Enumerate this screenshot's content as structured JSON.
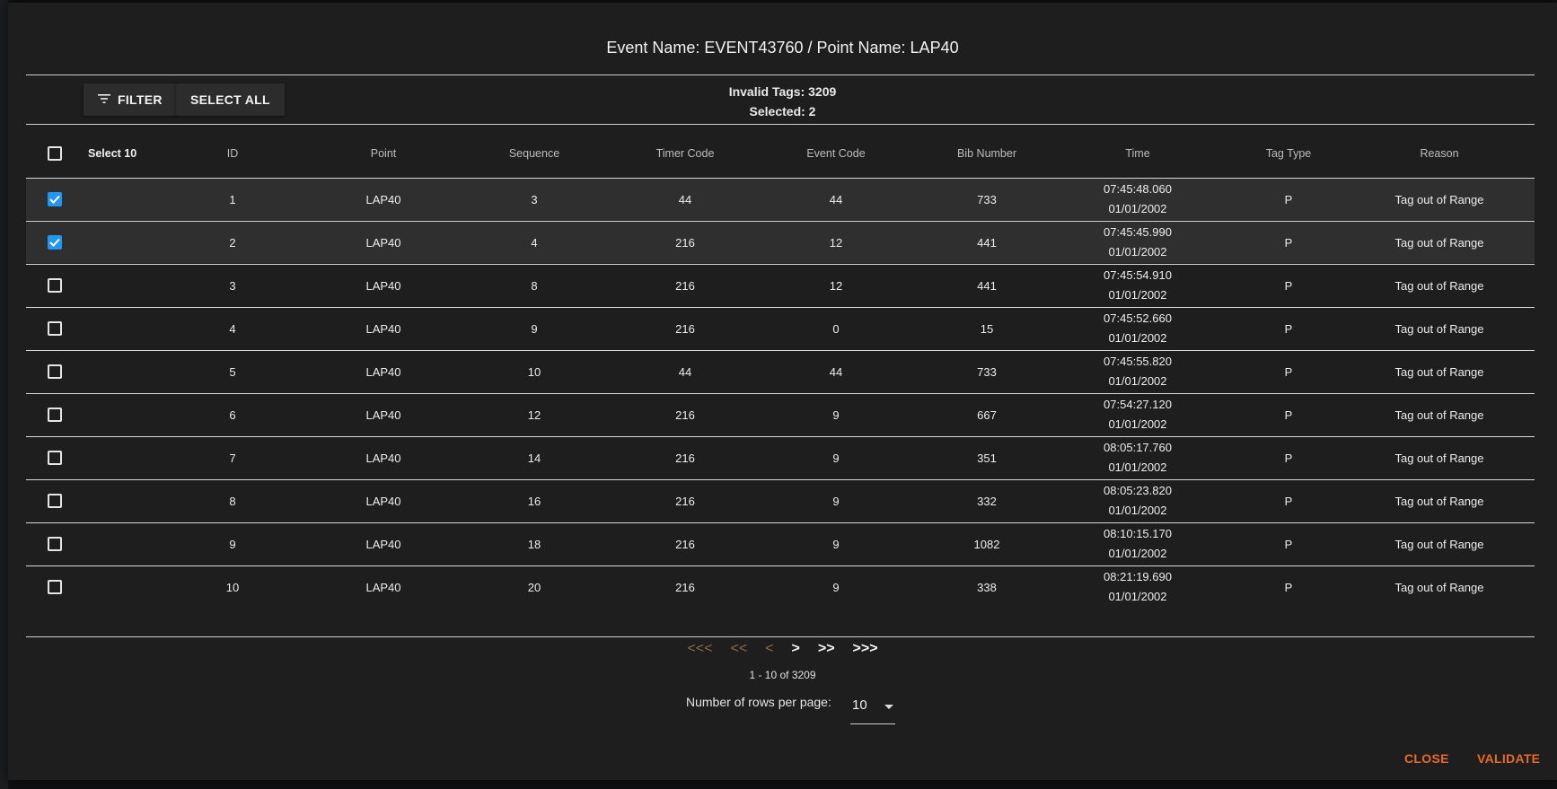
{
  "dialog": {
    "title": "Event Name: EVENT43760 / Point Name: LAP40",
    "toolbar": {
      "filter_label": "FILTER",
      "select_all_label": "SELECT ALL",
      "filter_icon": "filter-list-icon"
    },
    "stats": {
      "invalid_tags": "Invalid Tags: 3209",
      "selected": "Selected: 2"
    },
    "table": {
      "select_label": "Select 10",
      "columns": [
        "ID",
        "Point",
        "Sequence",
        "Timer Code",
        "Event Code",
        "Bib Number",
        "Time",
        "Tag Type",
        "Reason"
      ],
      "rows": [
        {
          "checked": true,
          "id": "1",
          "point": "LAP40",
          "sequence": "3",
          "timer_code": "44",
          "event_code": "44",
          "bib": "733",
          "time": "07:45:48.060",
          "date": "01/01/2002",
          "tag_type": "P",
          "reason": "Tag out of Range"
        },
        {
          "checked": true,
          "id": "2",
          "point": "LAP40",
          "sequence": "4",
          "timer_code": "216",
          "event_code": "12",
          "bib": "441",
          "time": "07:45:45.990",
          "date": "01/01/2002",
          "tag_type": "P",
          "reason": "Tag out of Range"
        },
        {
          "checked": false,
          "id": "3",
          "point": "LAP40",
          "sequence": "8",
          "timer_code": "216",
          "event_code": "12",
          "bib": "441",
          "time": "07:45:54.910",
          "date": "01/01/2002",
          "tag_type": "P",
          "reason": "Tag out of Range"
        },
        {
          "checked": false,
          "id": "4",
          "point": "LAP40",
          "sequence": "9",
          "timer_code": "216",
          "event_code": "0",
          "bib": "15",
          "time": "07:45:52.660",
          "date": "01/01/2002",
          "tag_type": "P",
          "reason": "Tag out of Range"
        },
        {
          "checked": false,
          "id": "5",
          "point": "LAP40",
          "sequence": "10",
          "timer_code": "44",
          "event_code": "44",
          "bib": "733",
          "time": "07:45:55.820",
          "date": "01/01/2002",
          "tag_type": "P",
          "reason": "Tag out of Range"
        },
        {
          "checked": false,
          "id": "6",
          "point": "LAP40",
          "sequence": "12",
          "timer_code": "216",
          "event_code": "9",
          "bib": "667",
          "time": "07:54:27.120",
          "date": "01/01/2002",
          "tag_type": "P",
          "reason": "Tag out of Range"
        },
        {
          "checked": false,
          "id": "7",
          "point": "LAP40",
          "sequence": "14",
          "timer_code": "216",
          "event_code": "9",
          "bib": "351",
          "time": "08:05:17.760",
          "date": "01/01/2002",
          "tag_type": "P",
          "reason": "Tag out of Range"
        },
        {
          "checked": false,
          "id": "8",
          "point": "LAP40",
          "sequence": "16",
          "timer_code": "216",
          "event_code": "9",
          "bib": "332",
          "time": "08:05:23.820",
          "date": "01/01/2002",
          "tag_type": "P",
          "reason": "Tag out of Range"
        },
        {
          "checked": false,
          "id": "9",
          "point": "LAP40",
          "sequence": "18",
          "timer_code": "216",
          "event_code": "9",
          "bib": "1082",
          "time": "08:10:15.170",
          "date": "01/01/2002",
          "tag_type": "P",
          "reason": "Tag out of Range"
        },
        {
          "checked": false,
          "id": "10",
          "point": "LAP40",
          "sequence": "20",
          "timer_code": "216",
          "event_code": "9",
          "bib": "338",
          "time": "08:21:19.690",
          "date": "01/01/2002",
          "tag_type": "P",
          "reason": "Tag out of Range"
        }
      ]
    },
    "pagination": {
      "first": "<<<",
      "prev_many": "<<",
      "prev": "<",
      "next": ">",
      "next_many": ">>",
      "last": ">>>",
      "range": "1 - 10 of 3209",
      "rows_per_page_label": "Number of rows per page:",
      "rows_per_page_value": "10"
    },
    "actions": {
      "close": "CLOSE",
      "validate": "VALIDATE"
    },
    "colors": {
      "accent": "#e8692a",
      "checkbox": "#2196f3",
      "disabled_pager": "#8a6a50"
    }
  }
}
